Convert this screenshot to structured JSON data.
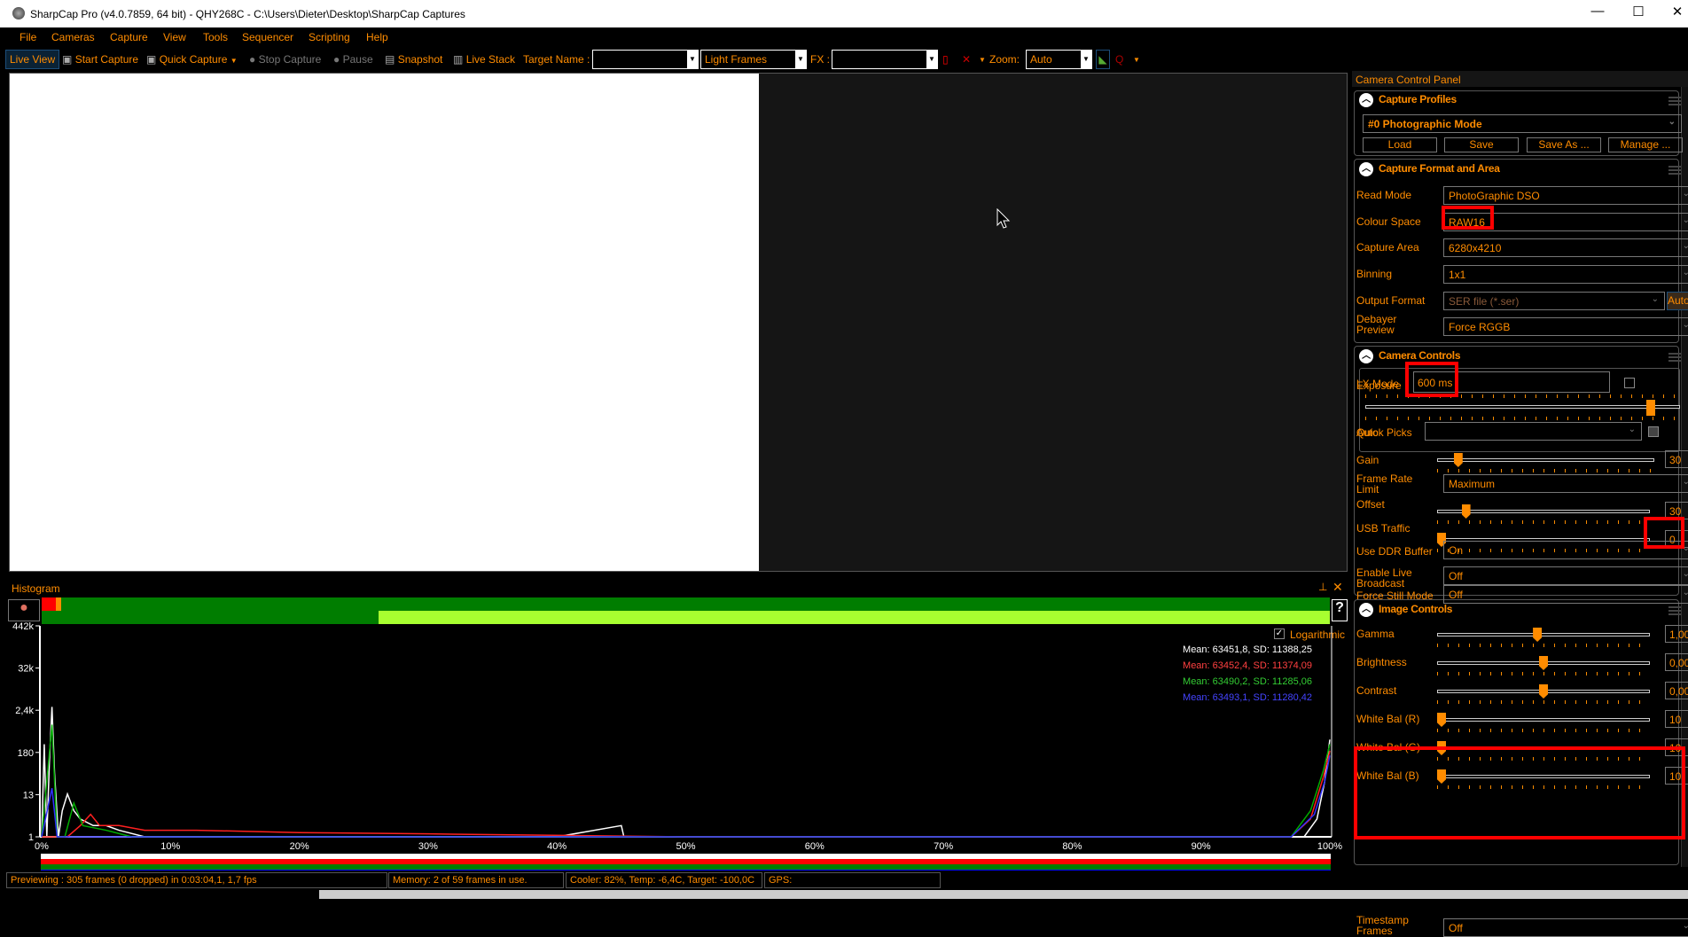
{
  "window": {
    "title": "SharpCap Pro (v4.0.7859, 64 bit) - QHY268C - C:\\Users\\Dieter\\Desktop\\SharpCap Captures",
    "minimize": "—",
    "maximize": "☐",
    "close": "✕"
  },
  "menu": [
    "File",
    "Cameras",
    "Capture",
    "View",
    "Tools",
    "Sequencer",
    "Scripting",
    "Help"
  ],
  "toolbar": {
    "live_view": "Live View",
    "start_capture": "Start Capture",
    "quick_capture": "Quick Capture",
    "stop_capture": "Stop Capture",
    "pause": "Pause",
    "snapshot": "Snapshot",
    "live_stack": "Live Stack",
    "target_name_label": "Target Name :",
    "target_name_value": "",
    "frame_type": "Light Frames",
    "fx_label": "FX :",
    "fx_value": "",
    "zoom_label": "Zoom:",
    "zoom_value": "Auto"
  },
  "panel": {
    "title": "Camera Control Panel",
    "profiles": {
      "title": "Capture Profiles",
      "profile": "#0 Photographic Mode",
      "load": "Load",
      "save": "Save",
      "save_as": "Save As ...",
      "manage": "Manage ..."
    },
    "format": {
      "title": "Capture Format and Area",
      "rows": [
        {
          "label": "Read Mode",
          "value": "PhotoGraphic DSO"
        },
        {
          "label": "Colour Space",
          "value": "RAW16"
        },
        {
          "label": "Capture Area",
          "value": "6280x4210"
        },
        {
          "label": "Binning",
          "value": "1x1"
        },
        {
          "label": "Output Format",
          "value": "SER file (*.ser)",
          "auto": "Auto"
        },
        {
          "label": "Debayer Preview",
          "value": "Force RGGB"
        }
      ]
    },
    "camera": {
      "title": "Camera Controls",
      "exposure_label": "Exposure",
      "exposure": "600 ms",
      "exposure_slider": 0.92,
      "lx_mode": "LX Mode",
      "lx_checked": false,
      "quick_picks_label": "Quick Picks",
      "quick_picks": "",
      "auto": "Auto",
      "auto_checked": false,
      "gain": {
        "label": "Gain",
        "value": "30",
        "pos": 0.08
      },
      "frame_rate": {
        "label": "Frame Rate Limit",
        "value": "Maximum"
      },
      "offset": {
        "label": "Offset",
        "value": "30",
        "pos": 0.12
      },
      "usb": {
        "label": "USB Traffic",
        "value": "0",
        "pos": 0
      },
      "ddr": {
        "label": "Use DDR Buffer",
        "value": "On"
      },
      "broadcast": {
        "label": "Enable Live Broadcast",
        "value": "Off"
      },
      "still": {
        "label": "Force Still Mode",
        "value": "Off"
      }
    },
    "image": {
      "title": "Image Controls",
      "sliders": [
        {
          "label": "Gamma",
          "value": "1,00",
          "pos": 0.47
        },
        {
          "label": "Brightness",
          "value": "0,00",
          "pos": 0.5
        },
        {
          "label": "Contrast",
          "value": "0,00",
          "pos": 0.5
        },
        {
          "label": "White Bal (R)",
          "value": "10",
          "pos": 0
        },
        {
          "label": "White Bal (G)",
          "value": "10",
          "pos": 0
        },
        {
          "label": "White Bal (B)",
          "value": "10",
          "pos": 0
        }
      ],
      "timestamp": {
        "label": "Timestamp Frames",
        "value": "Off"
      }
    }
  },
  "histogram": {
    "title": "Histogram",
    "logarithmic": "Logarithmic",
    "log_checked": true,
    "help": "?",
    "y_ticks": [
      "442k",
      "32k",
      "2,4k",
      "180",
      "13",
      "1"
    ],
    "x_ticks": [
      "0%",
      "10%",
      "20%",
      "30%",
      "40%",
      "50%",
      "60%",
      "70%",
      "80%",
      "90%",
      "100%"
    ],
    "stats": [
      {
        "text": "Mean: 63451,8, SD: 11388,25",
        "color": "#ffffff"
      },
      {
        "text": "Mean: 63452,4, SD: 11374,09",
        "color": "#ff4040"
      },
      {
        "text": "Mean: 63490,2, SD: 11285,06",
        "color": "#33cc33"
      },
      {
        "text": "Mean: 63493,1, SD: 11280,42",
        "color": "#4444ff"
      }
    ],
    "series": [
      {
        "color": "#ffffff",
        "points": [
          [
            0,
            1
          ],
          [
            0.2,
            300
          ],
          [
            0.4,
            1
          ],
          [
            0.6,
            100
          ],
          [
            0.8,
            3000
          ],
          [
            1,
            50
          ],
          [
            1.3,
            1
          ],
          [
            1.6,
            5
          ],
          [
            2,
            14
          ],
          [
            2.5,
            5
          ],
          [
            3,
            3
          ],
          [
            4,
            2
          ],
          [
            5,
            2
          ],
          [
            6,
            1.5
          ],
          [
            8,
            1
          ],
          [
            40,
            1
          ],
          [
            45,
            2
          ],
          [
            45.2,
            1
          ],
          [
            98,
            1
          ],
          [
            99,
            3
          ],
          [
            99.6,
            30
          ],
          [
            100,
            400
          ]
        ]
      },
      {
        "color": "#ff2020",
        "points": [
          [
            0,
            1
          ],
          [
            1,
            1
          ],
          [
            2,
            1
          ],
          [
            3,
            2
          ],
          [
            3.8,
            4
          ],
          [
            4.5,
            2
          ],
          [
            6,
            2
          ],
          [
            8,
            1.5
          ],
          [
            12,
            1.5
          ],
          [
            20,
            1.3
          ],
          [
            30,
            1.2
          ],
          [
            50,
            1
          ],
          [
            97,
            1
          ],
          [
            98.5,
            3
          ],
          [
            99.5,
            40
          ],
          [
            100,
            200
          ]
        ]
      },
      {
        "color": "#00aa00",
        "points": [
          [
            0,
            1
          ],
          [
            0.8,
            1000
          ],
          [
            1.2,
            1
          ],
          [
            1.8,
            1
          ],
          [
            2.5,
            8
          ],
          [
            3.2,
            2
          ],
          [
            5,
            1.5
          ],
          [
            7,
            1
          ],
          [
            97,
            1
          ],
          [
            98.5,
            5
          ],
          [
            99.5,
            60
          ],
          [
            100,
            300
          ]
        ]
      },
      {
        "color": "#3030ff",
        "points": [
          [
            0,
            1
          ],
          [
            0.8,
            20
          ],
          [
            1.2,
            1
          ],
          [
            97,
            1
          ],
          [
            98.8,
            4
          ],
          [
            99.6,
            30
          ],
          [
            100,
            150
          ]
        ]
      }
    ]
  },
  "status": {
    "preview": "Previewing : 305 frames (0 dropped) in 0:03:04,1, 1,7 fps",
    "memory": "Memory: 2 of 59 frames in use.",
    "cooler": "Cooler: 82%, Temp: -6,4C, Target: -100,0C",
    "gps": "GPS:"
  },
  "colors": {
    "accent": "#ff8c00",
    "annotation": "#ff0000"
  }
}
